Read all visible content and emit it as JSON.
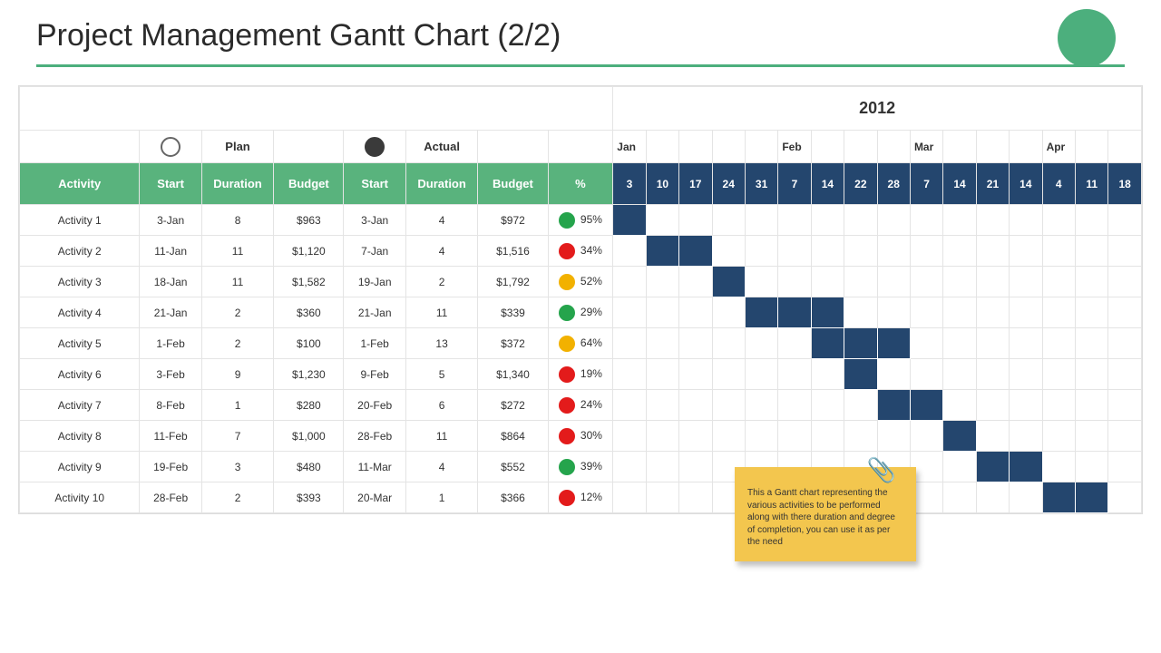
{
  "title": "Project Management Gantt Chart (2/2)",
  "year": "2012",
  "legend": {
    "plan": "Plan",
    "actual": "Actual"
  },
  "headers": {
    "activity": "Activity",
    "start": "Start",
    "duration": "Duration",
    "budget": "Budget",
    "percent": "%"
  },
  "months": [
    "Jan",
    "",
    "",
    "",
    "",
    "Feb",
    "",
    "",
    "",
    "Mar",
    "",
    "",
    "",
    "Apr",
    "",
    ""
  ],
  "days": [
    "3",
    "10",
    "17",
    "24",
    "31",
    "7",
    "14",
    "22",
    "28",
    "7",
    "14",
    "21",
    "14",
    "4",
    "11",
    "18"
  ],
  "activities": [
    {
      "name": "Activity 1",
      "p_start": "3-Jan",
      "p_dur": "8",
      "p_bud": "$963",
      "a_start": "3-Jan",
      "a_dur": "4",
      "a_bud": "$972",
      "status": "green",
      "pct": "95%",
      "bar_start": 0,
      "bar_len": 1
    },
    {
      "name": "Activity 2",
      "p_start": "11-Jan",
      "p_dur": "11",
      "p_bud": "$1,120",
      "a_start": "7-Jan",
      "a_dur": "4",
      "a_bud": "$1,516",
      "status": "red",
      "pct": "34%",
      "bar_start": 1,
      "bar_len": 2
    },
    {
      "name": "Activity 3",
      "p_start": "18-Jan",
      "p_dur": "11",
      "p_bud": "$1,582",
      "a_start": "19-Jan",
      "a_dur": "2",
      "a_bud": "$1,792",
      "status": "yellow",
      "pct": "52%",
      "bar_start": 3,
      "bar_len": 1
    },
    {
      "name": "Activity 4",
      "p_start": "21-Jan",
      "p_dur": "2",
      "p_bud": "$360",
      "a_start": "21-Jan",
      "a_dur": "11",
      "a_bud": "$339",
      "status": "green",
      "pct": "29%",
      "bar_start": 4,
      "bar_len": 3
    },
    {
      "name": "Activity 5",
      "p_start": "1-Feb",
      "p_dur": "2",
      "p_bud": "$100",
      "a_start": "1-Feb",
      "a_dur": "13",
      "a_bud": "$372",
      "status": "yellow",
      "pct": "64%",
      "bar_start": 6,
      "bar_len": 3
    },
    {
      "name": "Activity 6",
      "p_start": "3-Feb",
      "p_dur": "9",
      "p_bud": "$1,230",
      "a_start": "9-Feb",
      "a_dur": "5",
      "a_bud": "$1,340",
      "status": "red",
      "pct": "19%",
      "bar_start": 7,
      "bar_len": 1
    },
    {
      "name": "Activity 7",
      "p_start": "8-Feb",
      "p_dur": "1",
      "p_bud": "$280",
      "a_start": "20-Feb",
      "a_dur": "6",
      "a_bud": "$272",
      "status": "red",
      "pct": "24%",
      "bar_start": 8,
      "bar_len": 2
    },
    {
      "name": "Activity 8",
      "p_start": "11-Feb",
      "p_dur": "7",
      "p_bud": "$1,000",
      "a_start": "28-Feb",
      "a_dur": "11",
      "a_bud": "$864",
      "status": "red",
      "pct": "30%",
      "bar_start": 10,
      "bar_len": 1
    },
    {
      "name": "Activity 9",
      "p_start": "19-Feb",
      "p_dur": "3",
      "p_bud": "$480",
      "a_start": "11-Mar",
      "a_dur": "4",
      "a_bud": "$552",
      "status": "green",
      "pct": "39%",
      "bar_start": 11,
      "bar_len": 2
    },
    {
      "name": "Activity 10",
      "p_start": "28-Feb",
      "p_dur": "2",
      "p_bud": "$393",
      "a_start": "20-Mar",
      "a_dur": "1",
      "a_bud": "$366",
      "status": "red",
      "pct": "12%",
      "bar_start": 13,
      "bar_len": 2
    }
  ],
  "note": "This a Gantt chart representing the various activities to be performed along with there duration and degree of completion, you can use it as per the need",
  "colors": {
    "accent_green": "#59b37d",
    "navy": "#24466e",
    "status_green": "#25a44c",
    "status_red": "#e31b1b",
    "status_yellow": "#f2b100",
    "note_bg": "#f3c64e"
  },
  "chart_data": {
    "type": "gantt-table",
    "title": "Project Management Gantt Chart (2/2)",
    "year": 2012,
    "timeline": [
      {
        "month": "Jan",
        "days": [
          3,
          10,
          17,
          24,
          31
        ]
      },
      {
        "month": "Feb",
        "days": [
          7,
          14,
          22,
          28
        ]
      },
      {
        "month": "Mar",
        "days": [
          7,
          14,
          21,
          14
        ]
      },
      {
        "month": "Apr",
        "days": [
          4,
          11,
          18
        ]
      }
    ],
    "series": [
      {
        "name": "Activity 1",
        "plan": {
          "start": "3-Jan",
          "duration": 8,
          "budget": 963
        },
        "actual": {
          "start": "3-Jan",
          "duration": 4,
          "budget": 972
        },
        "percent": 95,
        "status": "green",
        "bar_index": 0,
        "bar_span": 1
      },
      {
        "name": "Activity 2",
        "plan": {
          "start": "11-Jan",
          "duration": 11,
          "budget": 1120
        },
        "actual": {
          "start": "7-Jan",
          "duration": 4,
          "budget": 1516
        },
        "percent": 34,
        "status": "red",
        "bar_index": 1,
        "bar_span": 2
      },
      {
        "name": "Activity 3",
        "plan": {
          "start": "18-Jan",
          "duration": 11,
          "budget": 1582
        },
        "actual": {
          "start": "19-Jan",
          "duration": 2,
          "budget": 1792
        },
        "percent": 52,
        "status": "yellow",
        "bar_index": 3,
        "bar_span": 1
      },
      {
        "name": "Activity 4",
        "plan": {
          "start": "21-Jan",
          "duration": 2,
          "budget": 360
        },
        "actual": {
          "start": "21-Jan",
          "duration": 11,
          "budget": 339
        },
        "percent": 29,
        "status": "green",
        "bar_index": 4,
        "bar_span": 3
      },
      {
        "name": "Activity 5",
        "plan": {
          "start": "1-Feb",
          "duration": 2,
          "budget": 100
        },
        "actual": {
          "start": "1-Feb",
          "duration": 13,
          "budget": 372
        },
        "percent": 64,
        "status": "yellow",
        "bar_index": 6,
        "bar_span": 3
      },
      {
        "name": "Activity 6",
        "plan": {
          "start": "3-Feb",
          "duration": 9,
          "budget": 1230
        },
        "actual": {
          "start": "9-Feb",
          "duration": 5,
          "budget": 1340
        },
        "percent": 19,
        "status": "red",
        "bar_index": 7,
        "bar_span": 1
      },
      {
        "name": "Activity 7",
        "plan": {
          "start": "8-Feb",
          "duration": 1,
          "budget": 280
        },
        "actual": {
          "start": "20-Feb",
          "duration": 6,
          "budget": 272
        },
        "percent": 24,
        "status": "red",
        "bar_index": 8,
        "bar_span": 2
      },
      {
        "name": "Activity 8",
        "plan": {
          "start": "11-Feb",
          "duration": 7,
          "budget": 1000
        },
        "actual": {
          "start": "28-Feb",
          "duration": 11,
          "budget": 864
        },
        "percent": 30,
        "status": "red",
        "bar_index": 10,
        "bar_span": 1
      },
      {
        "name": "Activity 9",
        "plan": {
          "start": "19-Feb",
          "duration": 3,
          "budget": 480
        },
        "actual": {
          "start": "11-Mar",
          "duration": 4,
          "budget": 552
        },
        "percent": 39,
        "status": "green",
        "bar_index": 11,
        "bar_span": 2
      },
      {
        "name": "Activity 10",
        "plan": {
          "start": "28-Feb",
          "duration": 2,
          "budget": 393
        },
        "actual": {
          "start": "20-Mar",
          "duration": 1,
          "budget": 366
        },
        "percent": 12,
        "status": "red",
        "bar_index": 13,
        "bar_span": 2
      }
    ]
  }
}
